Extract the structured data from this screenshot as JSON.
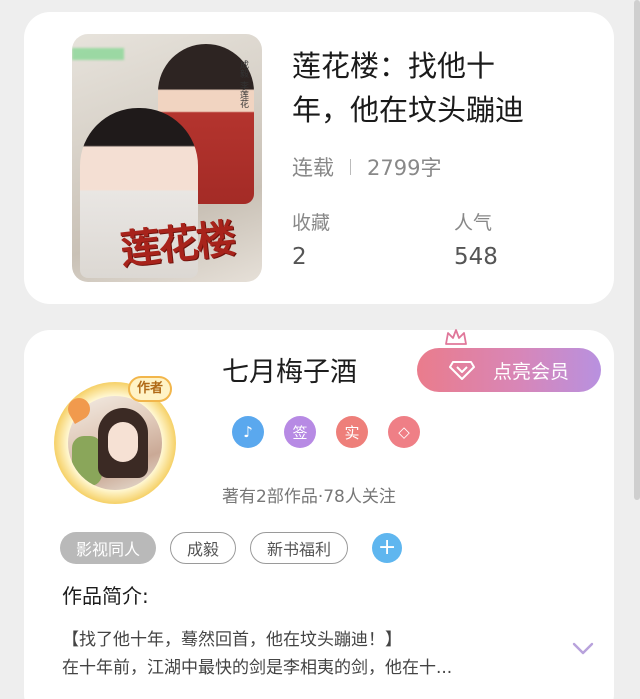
{
  "book": {
    "title_line1": "莲花楼：找他十",
    "title_line2": "年，他在坟头蹦迪",
    "status": "连载",
    "word_count": "2799字",
    "favorites_label": "收藏",
    "favorites_value": "2",
    "popularity_label": "人气",
    "popularity_value": "548",
    "cover": {
      "title_art": "莲花楼",
      "side_text": "成毅 李莲花"
    }
  },
  "author": {
    "name": "七月梅子酒",
    "avatar_badge": "作者",
    "vip_button_label": "点亮会员",
    "badges": [
      {
        "icon": "music-note-icon",
        "text": "♪",
        "color": "#5aa8ee"
      },
      {
        "icon": "sign-icon",
        "text": "签",
        "color": "#b78ae4"
      },
      {
        "icon": "real-name-icon",
        "text": "实",
        "color": "#ee7f7a"
      },
      {
        "icon": "diamond-icon",
        "text": "◇",
        "color": "#ef7f86"
      }
    ],
    "works_summary": "著有2部作品·78人关注"
  },
  "tags": [
    "影视同人",
    "成毅",
    "新书福利"
  ],
  "intro": {
    "title": "作品简介:",
    "line1": "【找了他十年，蓦然回首，他在坟头蹦迪！】",
    "line2": "在十年前，江湖中最快的剑是李相夷的剑，他在十..."
  },
  "colors": {
    "vip_gradient_start": "#ea7c8c",
    "vip_gradient_end": "#b891e0",
    "expand_arrow": "#b8a2dc",
    "plus_button": "#5fb6ef"
  }
}
